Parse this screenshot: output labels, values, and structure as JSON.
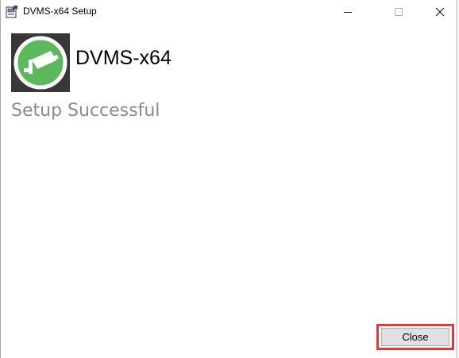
{
  "window": {
    "title": "DVMS-x64 Setup",
    "controls": {
      "minimize": "minimize-icon",
      "maximize": "maximize-icon",
      "close": "close-icon"
    }
  },
  "header": {
    "product_name": "DVMS-x64",
    "logo_icon": "security-camera-icon",
    "logo_colors": {
      "background": "#383838",
      "circle": "#5cb85c",
      "glyph": "#ffffff"
    }
  },
  "main": {
    "status": "Setup Successful"
  },
  "footer": {
    "close_label": "Close",
    "highlight_color": "#e03b3b"
  }
}
